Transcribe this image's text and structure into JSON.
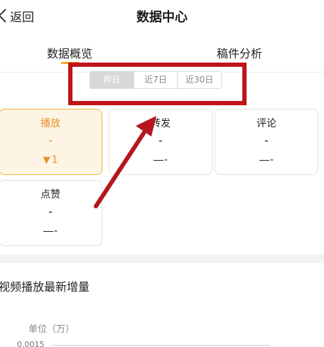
{
  "header": {
    "back_label": "返回",
    "title": "数据中心"
  },
  "tabs": [
    {
      "label": "数据概览",
      "active": true
    },
    {
      "label": "稿件分析",
      "active": false
    }
  ],
  "date_range": {
    "options": [
      "昨日",
      "近7日",
      "近30日"
    ],
    "selected": "昨日"
  },
  "metrics": [
    {
      "label": "播放",
      "value": "-",
      "change": "1",
      "active": true
    },
    {
      "label": "转发",
      "value": "-",
      "change": "-"
    },
    {
      "label": "评论",
      "value": "-",
      "change": "-"
    },
    {
      "label": "点赞",
      "value": "-",
      "change": "-"
    }
  ],
  "chart_section": {
    "title": "视频播放最新增量",
    "unit": "单位（万）",
    "y_tick": "0.0015"
  },
  "annotation": {
    "box_color": "#c0141b",
    "arrow_color": "#b5171c"
  },
  "accent_color": "#f5a623"
}
